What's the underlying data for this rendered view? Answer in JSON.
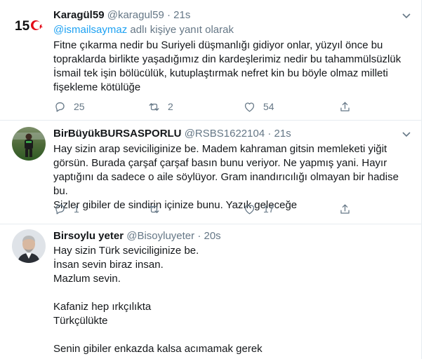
{
  "tweets": [
    {
      "name": "Karagül59",
      "handle": "@karagul59",
      "dot": "·",
      "time": "21s",
      "reply_prefix": "@ismailsaymaz",
      "reply_suffix": " adlı kişiye yanıt olarak",
      "text": "Fitne çıkarma nedir bu Suriyeli düşmanlığı gidiyor onlar, yüzyıl önce bu\ntopraklarda birlikte yaşadığımız din kardeşlerimiz nedir bu tahammülsüzlük\nİsmail tek işin bölücülük, kutuplaştırmak nefret kin bu böyle olmaz milleti\nfişekleme kötülüğe",
      "avatar_icon": "15-temmuz-logo",
      "avatar_badge": "15",
      "counts": {
        "reply": "25",
        "retweet": "2",
        "like": "54"
      }
    },
    {
      "name": "BirBüyükBURSASPORLU",
      "handle": "@RSBS1622104",
      "dot": "·",
      "time": "21s",
      "text": "Hay sizin arap seviciliginize be. Madem kahraman gitsin memleketi yiğit\ngörsün. Burada çarşaf çarşaf basın bunu veriyor. Ne yapmış yani. Hayır\nyaptığını da sadece o aile söylüyor. Gram inandırıcılığı olmayan bir hadise bu.\nSizler gibiler de sindirin içinize bunu. Yazık geleceğe",
      "avatar_icon": "football-player-photo",
      "counts": {
        "reply": "1",
        "retweet": "",
        "like": "17"
      }
    },
    {
      "name": "Birsoylu yeter",
      "handle": "@Bisoyluyeter",
      "dot": "·",
      "time": "20s",
      "text": "Hay sizin Türk seviciliginize be.\nİnsan sevin biraz insan.\nMazlum sevin.\n\nKafaniz hep ırkçılıkta\nTürkçülükte\n\nSenin gibiler enkazda kalsa acımamak gerek",
      "avatar_icon": "man-portrait-photo"
    }
  ],
  "colors": {
    "link": "#1da1f2",
    "muted": "#657786",
    "border": "#e6ecf0"
  }
}
